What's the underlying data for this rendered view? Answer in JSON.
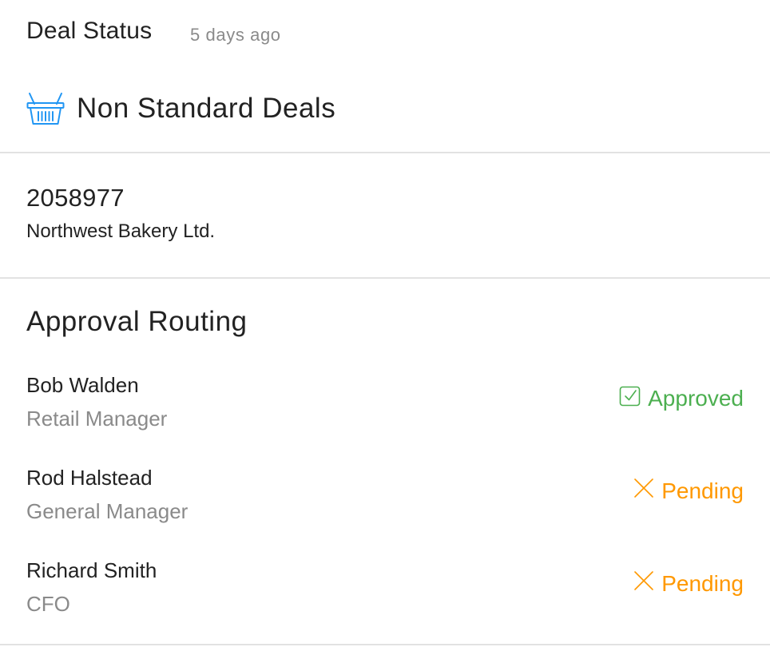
{
  "header": {
    "title": "Deal Status",
    "timestamp": "5 days ago"
  },
  "category": {
    "icon": "basket-icon",
    "label": "Non Standard Deals",
    "icon_color": "#2196f3"
  },
  "deal": {
    "id": "2058977",
    "company": "Northwest Bakery Ltd."
  },
  "approval_routing": {
    "title": "Approval Routing",
    "approvers": [
      {
        "name": "Bob Walden",
        "role": "Retail Manager",
        "status": "Approved",
        "status_icon": "checkbox-checked-icon",
        "status_color": "#4caf50"
      },
      {
        "name": "Rod Halstead",
        "role": "General Manager",
        "status": "Pending",
        "status_icon": "close-icon",
        "status_color": "#ff9800"
      },
      {
        "name": "Richard Smith",
        "role": "CFO",
        "status": "Pending",
        "status_icon": "close-icon",
        "status_color": "#ff9800"
      }
    ]
  }
}
